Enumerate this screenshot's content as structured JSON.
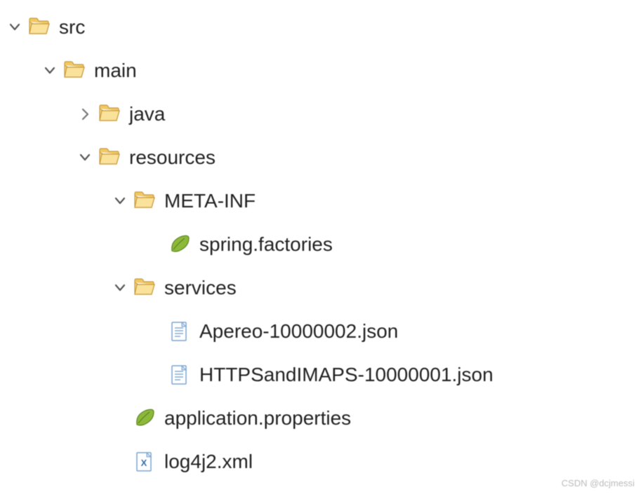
{
  "tree": {
    "src": "src",
    "main": "main",
    "java": "java",
    "resources": "resources",
    "metainf": "META-INF",
    "spring_factories": "spring.factories",
    "services": "services",
    "apereo": "Apereo-10000002.json",
    "httpsimaps": "HTTPSandIMAPS-10000001.json",
    "app_props": "application.properties",
    "log4j2": "log4j2.xml"
  },
  "watermark": "CSDN @dcjmessi"
}
